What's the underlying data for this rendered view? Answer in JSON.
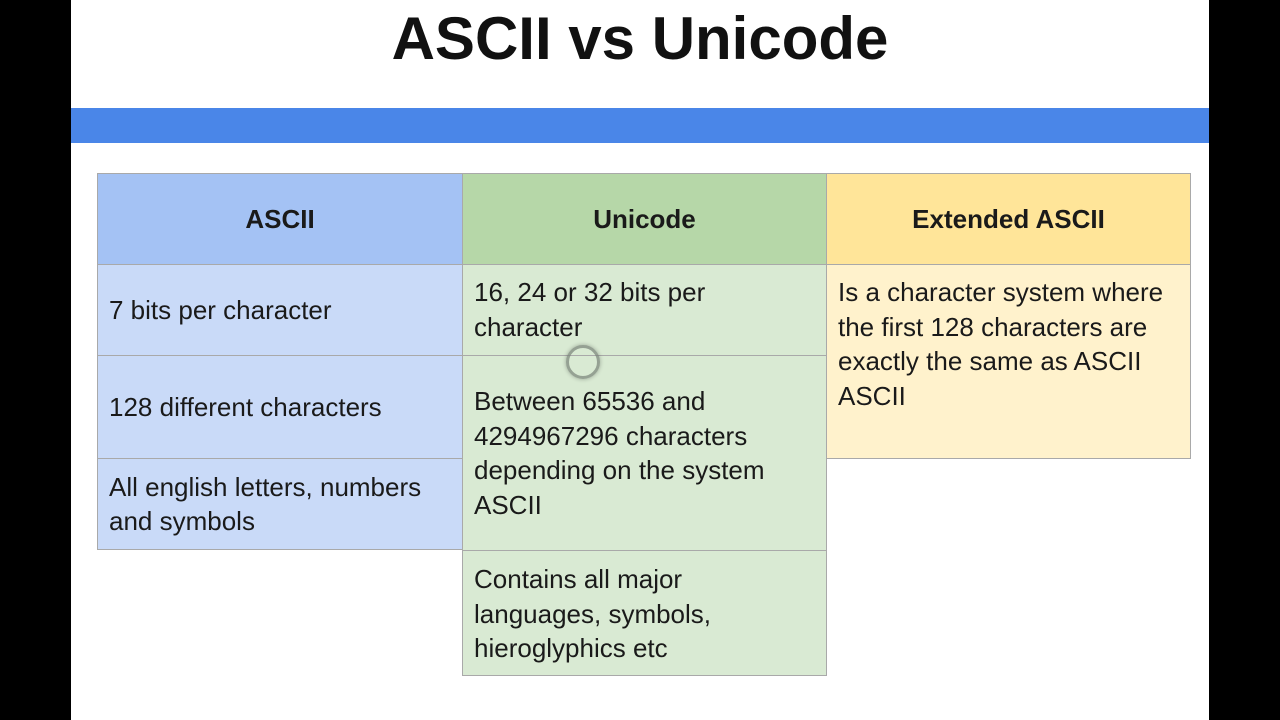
{
  "title": "ASCII vs Unicode",
  "columns": [
    {
      "header": "ASCII",
      "cells": [
        "7 bits per character",
        "128 different characters",
        "All english letters, numbers and symbols"
      ]
    },
    {
      "header": "Unicode",
      "cells": [
        "16, 24 or 32 bits per character",
        "Between 65536 and 4294967296 characters depending on the system ASCII",
        "Contains all major languages, symbols, hieroglyphics etc"
      ]
    },
    {
      "header": "Extended ASCII",
      "cells": [
        "Is a character system where the first 128 characters are exactly the same as ASCII\nASCII"
      ]
    }
  ],
  "colors": {
    "band": "#4a86e8",
    "ascii": "#a4c2f4",
    "unicode": "#b6d7a8",
    "extended": "#ffe599"
  }
}
